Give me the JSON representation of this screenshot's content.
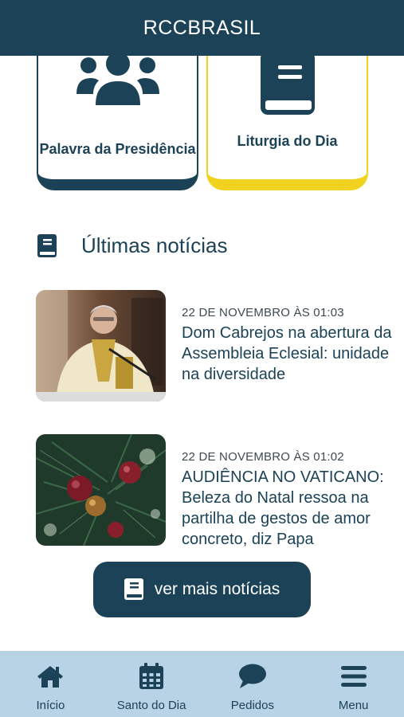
{
  "header": {
    "title": "RCCBRASIL"
  },
  "cards": [
    {
      "label": "Palavra da Presidência",
      "icon": "users-group-icon"
    },
    {
      "label": "Liturgia do Dia",
      "icon": "book-icon"
    }
  ],
  "section": {
    "title": "Últimas notícias",
    "icon": "book-icon"
  },
  "news": [
    {
      "date": "22 DE NOVEMBRO ÀS 01:03",
      "title": "Dom Cabrejos na abertura da Assembleia Eclesial: unidade na diversidade"
    },
    {
      "date": "22 DE NOVEMBRO ÀS 01:02",
      "title": "AUDIÊNCIA NO VATICANO: Beleza do Natal ressoa na partilha de gestos de amor concreto, diz Papa"
    }
  ],
  "more_button": {
    "label": "ver mais notícias"
  },
  "tabbar": {
    "items": [
      {
        "label": "Início",
        "icon": "home-icon"
      },
      {
        "label": "Santo do Dia",
        "icon": "calendar-icon"
      },
      {
        "label": "Pedidos",
        "icon": "speech-bubble-icon"
      },
      {
        "label": "Menu",
        "icon": "hamburger-menu-icon"
      }
    ]
  },
  "colors": {
    "primary": "#1b4256",
    "accent": "#f1d21f",
    "tabbar_bg": "#b8d3e6"
  }
}
